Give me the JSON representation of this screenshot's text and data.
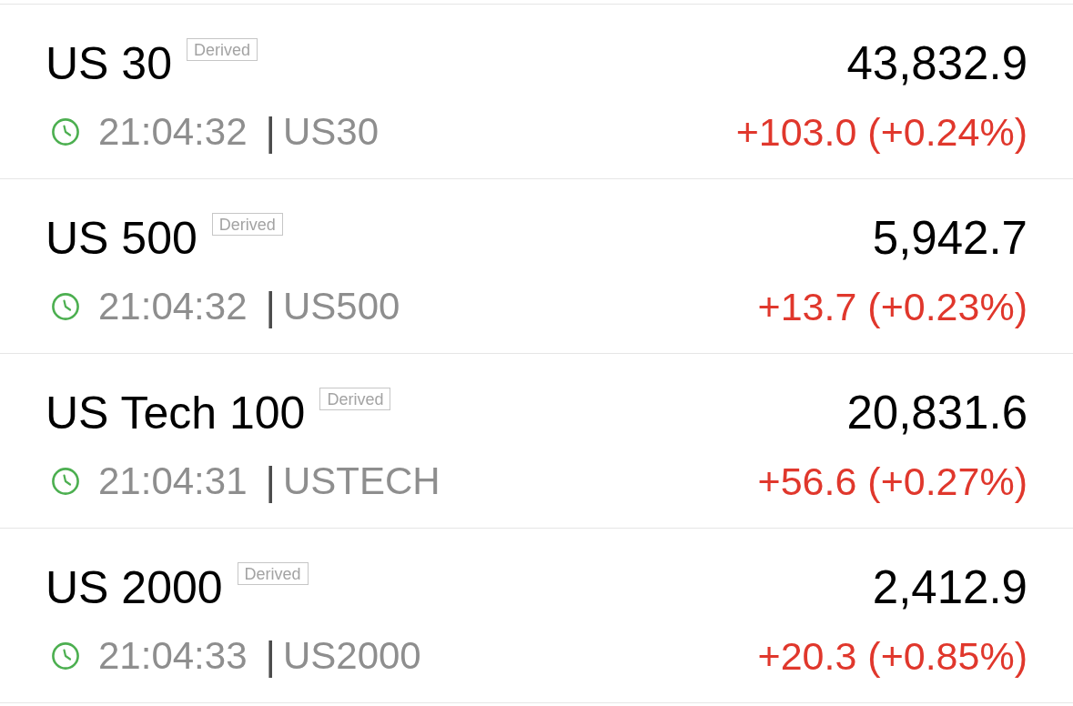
{
  "instruments": [
    {
      "name": "US 30",
      "badge": "Derived",
      "price": "43,832.9",
      "time": "21:04:32",
      "separator": "|",
      "symbol": "US30",
      "change": "+103.0 (+0.24%)"
    },
    {
      "name": "US 500",
      "badge": "Derived",
      "price": "5,942.7",
      "time": "21:04:32",
      "separator": "|",
      "symbol": "US500",
      "change": "+13.7 (+0.23%)"
    },
    {
      "name": "US Tech 100",
      "badge": "Derived",
      "price": "20,831.6",
      "time": "21:04:31",
      "separator": "|",
      "symbol": "USTECH",
      "change": "+56.6 (+0.27%)"
    },
    {
      "name": "US 2000",
      "badge": "Derived",
      "price": "2,412.9",
      "time": "21:04:33",
      "separator": "|",
      "symbol": "US2000",
      "change": "+20.3 (+0.85%)"
    }
  ]
}
